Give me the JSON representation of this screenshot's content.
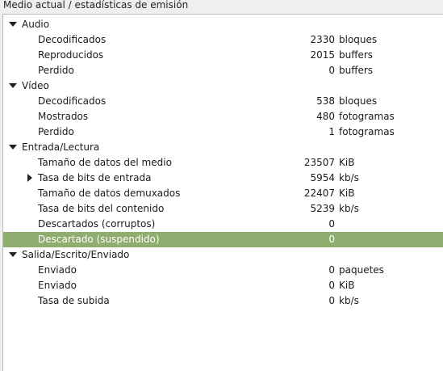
{
  "header": {
    "title": "Medio actual / estadísticas de emisión"
  },
  "tree": {
    "sections": [
      {
        "label": "Audio",
        "expanded": true,
        "items": [
          {
            "label": "Decodificados",
            "value": "2330",
            "unit": "bloques"
          },
          {
            "label": "Reproducidos",
            "value": "2015",
            "unit": "buffers"
          },
          {
            "label": "Perdido",
            "value": "0",
            "unit": "buffers"
          }
        ]
      },
      {
        "label": "Vídeo",
        "expanded": true,
        "items": [
          {
            "label": "Decodificados",
            "value": "538",
            "unit": "bloques"
          },
          {
            "label": "Mostrados",
            "value": "480",
            "unit": "fotogramas"
          },
          {
            "label": "Perdido",
            "value": "1",
            "unit": "fotogramas"
          }
        ]
      },
      {
        "label": "Entrada/Lectura",
        "expanded": true,
        "items": [
          {
            "label": "Tamaño de datos del medio",
            "value": "23507",
            "unit": "KiB"
          },
          {
            "label": "Tasa de bits de entrada",
            "value": "5954",
            "unit": "kb/s",
            "has_children": true
          },
          {
            "label": "Tamaño de datos demuxados",
            "value": "22407",
            "unit": "KiB"
          },
          {
            "label": "Tasa de bits del contenido",
            "value": "5239",
            "unit": "kb/s"
          },
          {
            "label": "Descartados (corruptos)",
            "value": "0",
            "unit": ""
          },
          {
            "label": "Descartado (suspendido)",
            "value": "0",
            "unit": "",
            "selected": true
          }
        ]
      },
      {
        "label": "Salida/Escrito/Enviado",
        "expanded": true,
        "items": [
          {
            "label": "Enviado",
            "value": "0",
            "unit": "paquetes"
          },
          {
            "label": "Enviado",
            "value": "0",
            "unit": "KiB"
          },
          {
            "label": "Tasa de subida",
            "value": "0",
            "unit": "kb/s"
          }
        ]
      }
    ]
  },
  "colors": {
    "selection": "#8fad6e",
    "arrow": "#222222"
  },
  "icons": {
    "expanded": "triangle-down-icon",
    "collapsed": "triangle-right-icon"
  }
}
